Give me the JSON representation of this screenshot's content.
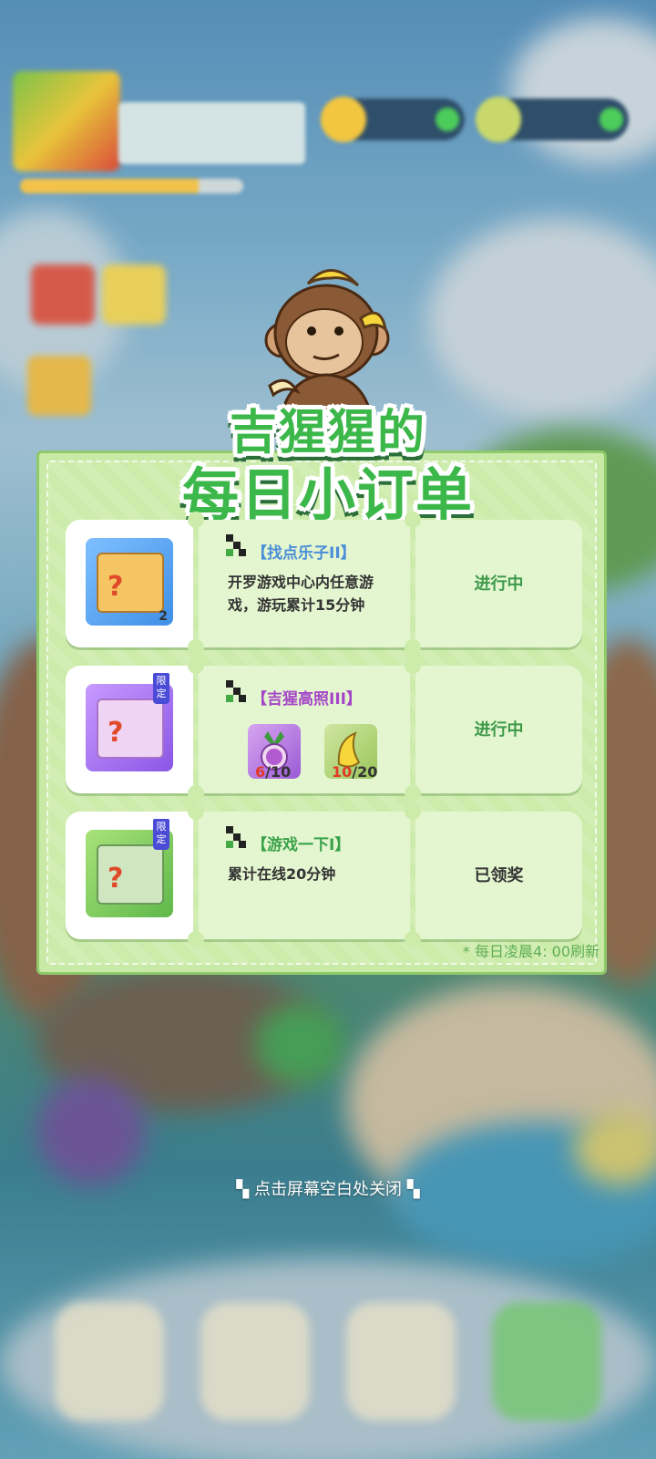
{
  "hud": {
    "player_name": "",
    "coin_value": "",
    "gem_value": ""
  },
  "banner": {
    "title_line1": "吉猩猩的",
    "title_line2": "每日小订单"
  },
  "tasks": [
    {
      "title": "【找点乐子II】",
      "title_color": "#4a8ed8",
      "desc": "开罗游戏中心内任意游戏，游玩累计15分钟",
      "status": "进行中",
      "status_color": "#3d9a4a",
      "reward": "blue-mystery-box",
      "reward_count": "2"
    },
    {
      "title": "【吉猩高照III】",
      "title_color": "#a546c8",
      "status": "进行中",
      "status_color": "#3d9a4a",
      "reward": "purple-limited-box",
      "limited_badge": "限定",
      "items": [
        {
          "icon": "turnip-icon",
          "have": "6",
          "need": "/10"
        },
        {
          "icon": "banana-icon",
          "have": "10",
          "need": "/20"
        }
      ]
    },
    {
      "title": "【游戏一下I】",
      "title_color": "#3aa24a",
      "desc": "累计在线20分钟",
      "status": "已领奖",
      "status_color": "#333333",
      "reward": "green-limited-box",
      "limited_badge": "限定"
    }
  ],
  "refresh_note": "* 每日凌晨4: 00刷新",
  "close_hint": "点击屏幕空白处关闭"
}
